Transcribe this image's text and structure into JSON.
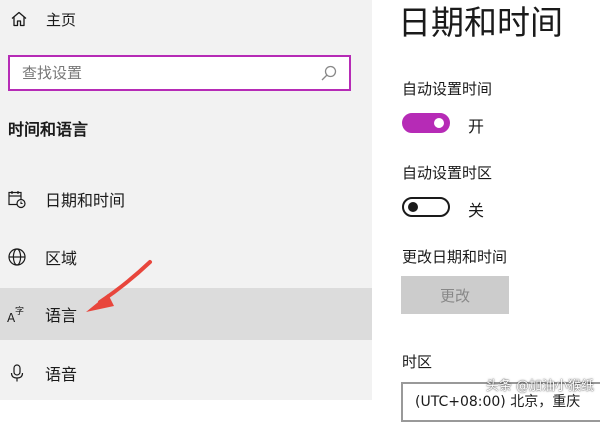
{
  "sidebar": {
    "home_label": "主页",
    "search_placeholder": "查找设置",
    "section_title": "时间和语言",
    "items": [
      {
        "label": "日期和时间",
        "icon": "calendar-clock-icon"
      },
      {
        "label": "区域",
        "icon": "globe-icon"
      },
      {
        "label": "语言",
        "icon": "language-icon",
        "selected": true
      },
      {
        "label": "语音",
        "icon": "microphone-icon"
      }
    ]
  },
  "main": {
    "title": "日期和时间",
    "auto_time_label": "自动设置时间",
    "auto_time_state": "开",
    "auto_time_on": true,
    "auto_timezone_label": "自动设置时区",
    "auto_timezone_state": "关",
    "auto_timezone_on": false,
    "change_datetime_label": "更改日期和时间",
    "change_button": "更改",
    "timezone_label": "时区",
    "timezone_value": "(UTC+08:00) 北京，重庆"
  },
  "watermark": "头条 @加油小猴纸",
  "colors": {
    "accent": "#b62bb6",
    "sidebar_bg": "#f2f2f2",
    "selected_bg": "#dcdcdc",
    "annotation_arrow": "#e8463c"
  }
}
